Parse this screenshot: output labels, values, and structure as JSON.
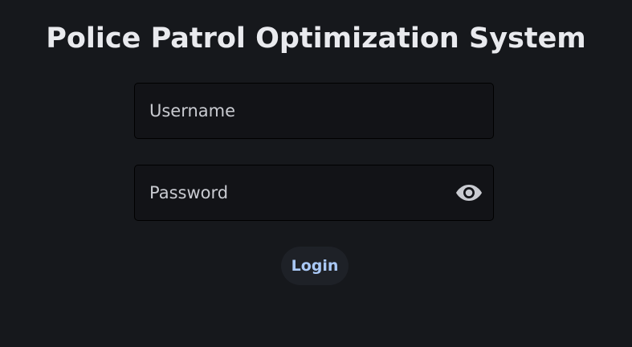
{
  "page": {
    "title": "Police Patrol Optimization System"
  },
  "form": {
    "username": {
      "placeholder": "Username",
      "value": ""
    },
    "password": {
      "placeholder": "Password",
      "value": "",
      "toggle_icon": "eye-icon"
    },
    "login_label": "Login"
  },
  "colors": {
    "background": "#16181c",
    "field_background": "#121317",
    "title": "#e9eaee",
    "login_text": "#a9c8f5",
    "login_background": "#1e2127"
  }
}
